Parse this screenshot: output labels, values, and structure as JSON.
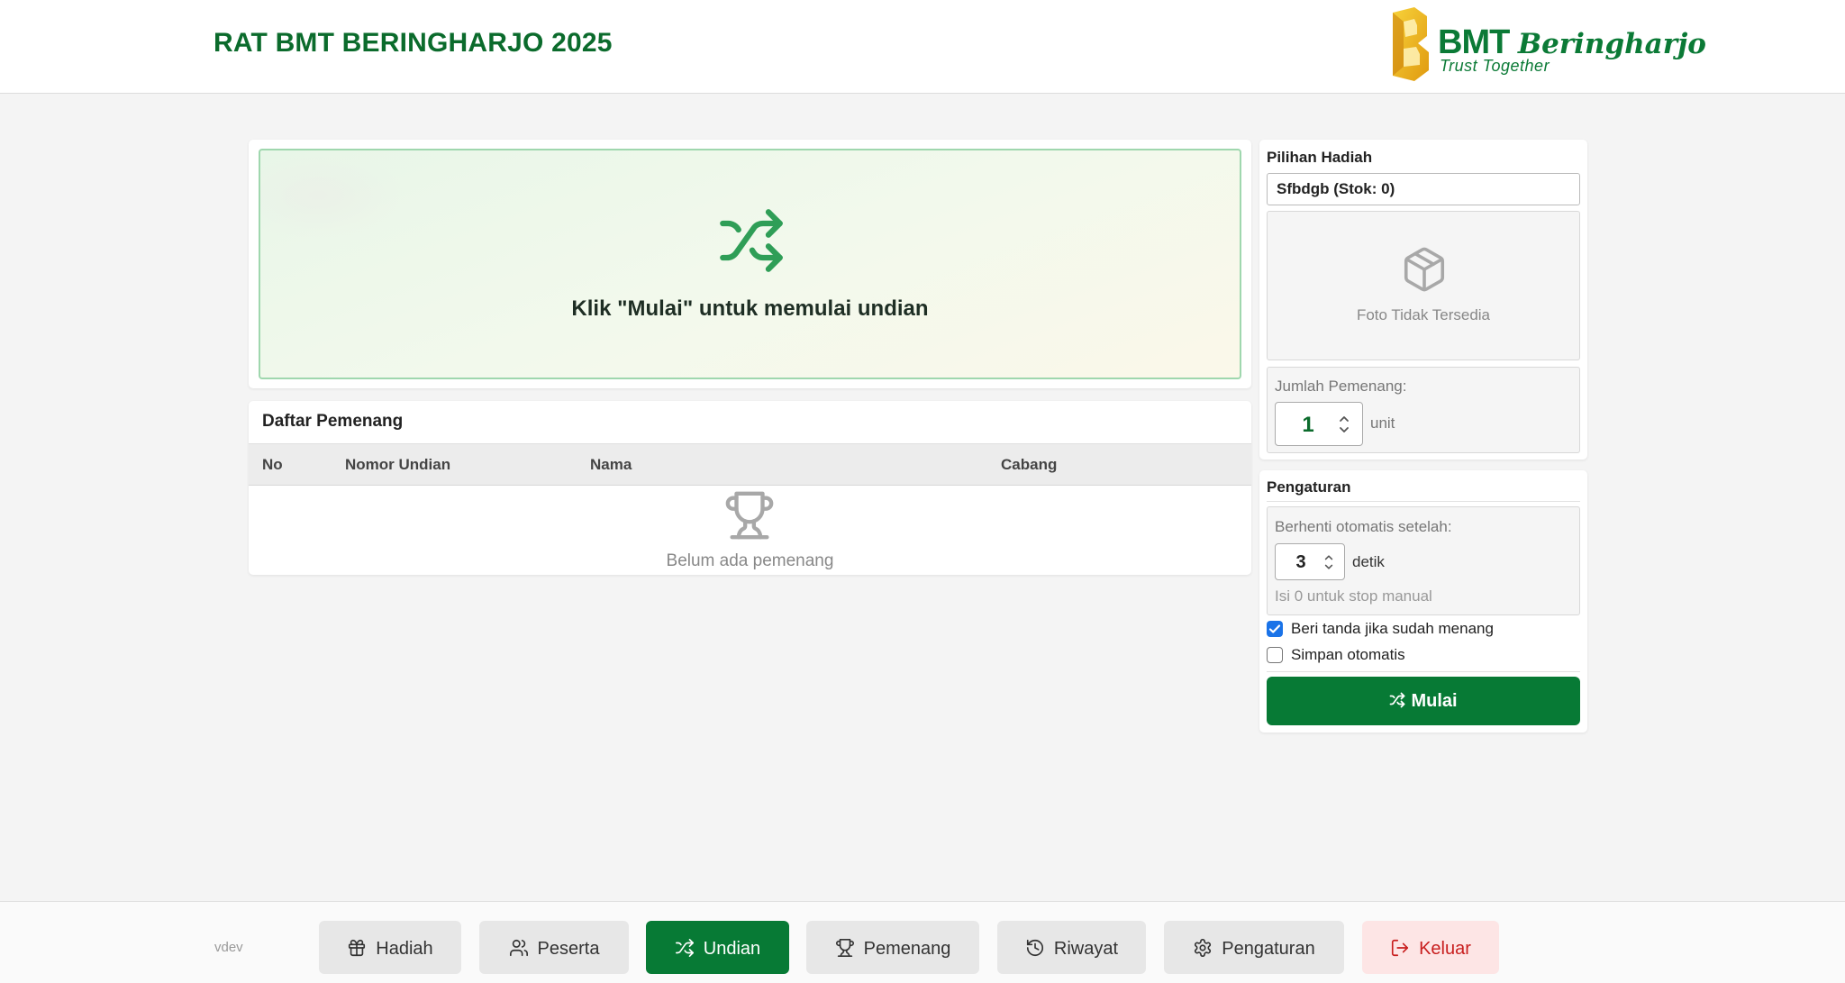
{
  "header": {
    "title": "RAT BMT BERINGHARJO 2025",
    "logo_word1": "BMT",
    "logo_word2": "Beringharjo",
    "logo_tagline": "Trust Together"
  },
  "draw": {
    "icon": "shuffle-icon",
    "message": "Klik \"Mulai\" untuk memulai undian"
  },
  "winners": {
    "title": "Daftar Pemenang",
    "columns": [
      "No",
      "Nomor Undian",
      "Nama",
      "Cabang"
    ],
    "rows": [],
    "empty_icon": "trophy-icon",
    "empty_message": "Belum ada pemenang"
  },
  "prize": {
    "title": "Pilihan Hadiah",
    "selected": "Sfbdgb (Stok: 0)",
    "photo_icon": "box-icon",
    "photo_message": "Foto Tidak Tersedia",
    "quantity_label": "Jumlah Pemenang:",
    "quantity_value": "1",
    "quantity_unit": "unit"
  },
  "settings": {
    "title": "Pengaturan",
    "auto_stop_label": "Berhenti otomatis setelah:",
    "auto_stop_value": "3",
    "auto_stop_unit": "detik",
    "auto_stop_hint": "Isi 0 untuk stop manual",
    "mark_winner_label": "Beri tanda jika sudah menang",
    "mark_winner_checked": true,
    "auto_save_label": "Simpan otomatis",
    "auto_save_checked": false,
    "start_label": "Mulai"
  },
  "footer": {
    "version": "vdev",
    "nav": [
      {
        "label": "Hadiah",
        "icon": "gift-icon"
      },
      {
        "label": "Peserta",
        "icon": "users-icon"
      },
      {
        "label": "Undian",
        "icon": "shuffle-icon",
        "active": true
      },
      {
        "label": "Pemenang",
        "icon": "trophy-icon"
      },
      {
        "label": "Riwayat",
        "icon": "history-icon"
      },
      {
        "label": "Pengaturan",
        "icon": "gear-icon"
      },
      {
        "label": "Keluar",
        "icon": "logout-icon"
      }
    ]
  },
  "colors": {
    "brand_green": "#077a35",
    "header_green": "#0b6b2c",
    "danger_red": "#c81e1e",
    "checkbox_blue": "#1a73e8"
  }
}
